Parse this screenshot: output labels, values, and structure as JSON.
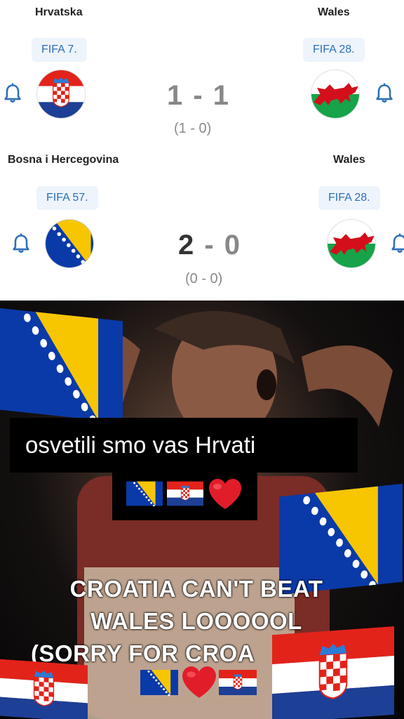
{
  "matches": [
    {
      "home": {
        "name": "Hrvatska",
        "rank": "FIFA 7.",
        "flag": "croatia"
      },
      "away": {
        "name": "Wales",
        "rank": "FIFA 28.",
        "flag": "wales"
      },
      "score": "1 - 1",
      "halftime": "(1 - 0)"
    },
    {
      "home": {
        "name": "Bosna i Hercegovina",
        "rank": "FIFA 57.",
        "flag": "bosnia"
      },
      "away": {
        "name": "Wales",
        "rank": "FIFA 28.",
        "flag": "wales"
      },
      "score": "2 - 0",
      "halftime": "(0 - 0)"
    }
  ],
  "overlay": {
    "caption": "osvetili smo vas Hrvati",
    "caption_emojis": [
      "bosnia-flag-emoji",
      "croatia-flag-emoji",
      "heart-emoji"
    ],
    "banner_line1": "CROATIA CAN'T BEAT",
    "banner_line2": "WALES LOOOOOL",
    "banner_line3": "(SORRY FOR CROA",
    "banner_emojis": [
      "bosnia-flag-emoji",
      "heart-emoji",
      "croatia-flag-emoji"
    ]
  },
  "colors": {
    "score_dark": "#333333",
    "score_light": "#888888",
    "fifa_text": "#2d6fb8",
    "bell": "#2d6fb8",
    "bosnia_blue": "#0a3aa8",
    "bosnia_yellow": "#f7c600",
    "croatia_red": "#e2231a",
    "croatia_blue": "#1d3f95",
    "wales_green": "#16a34a",
    "wales_red": "#d30f1c"
  }
}
